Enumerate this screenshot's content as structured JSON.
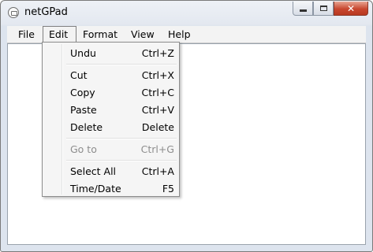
{
  "window": {
    "title": "netGPad"
  },
  "menubar": [
    {
      "label": "File"
    },
    {
      "label": "Edit"
    },
    {
      "label": "Format"
    },
    {
      "label": "View"
    },
    {
      "label": "Help"
    }
  ],
  "edit_menu": {
    "items": [
      {
        "label": "Undu",
        "shortcut": "Ctrl+Z",
        "enabled": true
      },
      {
        "label": "Cut",
        "shortcut": "Ctrl+X",
        "enabled": true
      },
      {
        "label": "Copy",
        "shortcut": "Ctrl+C",
        "enabled": true
      },
      {
        "label": "Paste",
        "shortcut": "Ctrl+V",
        "enabled": true
      },
      {
        "label": "Delete",
        "shortcut": "Delete",
        "enabled": true
      },
      {
        "label": "Go to",
        "shortcut": "Ctrl+G",
        "enabled": false
      },
      {
        "label": "Select All",
        "shortcut": "Ctrl+A",
        "enabled": true
      },
      {
        "label": "Time/Date",
        "shortcut": "F5",
        "enabled": true
      }
    ]
  },
  "editor": {
    "content": ""
  },
  "icons": {
    "app": "notepad-app-icon",
    "minimize": "minimize-icon",
    "maximize": "maximize-icon",
    "close": "close-icon"
  }
}
